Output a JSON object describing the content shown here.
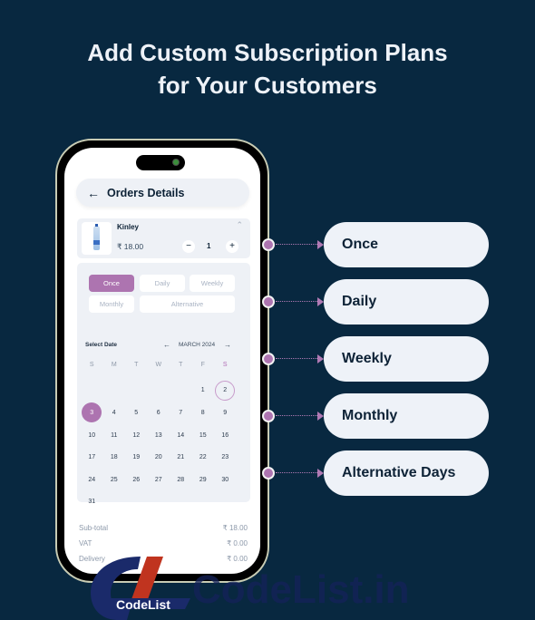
{
  "headline": {
    "line1": "Add Custom Subscription Plans",
    "line2": "for Your Customers"
  },
  "phone": {
    "header": {
      "back_icon": "arrow-left-icon",
      "title": "Orders Details"
    },
    "item": {
      "name": "Kinley",
      "price": "₹ 18.00",
      "quantity": "1",
      "minus_label": "−",
      "plus_label": "+",
      "collapse_icon": "chevron-up-icon"
    },
    "plans": {
      "options": [
        {
          "label": "Once",
          "active": true
        },
        {
          "label": "Daily",
          "active": false
        },
        {
          "label": "Weekly",
          "active": false
        },
        {
          "label": "Monthly",
          "active": false
        },
        {
          "label": "Alternative",
          "active": false
        }
      ]
    },
    "calendar": {
      "select_label": "Select Date",
      "month": "MARCH 2024",
      "prev_icon": "arrow-left-icon",
      "next_icon": "arrow-right-icon",
      "weekdays": [
        "S",
        "M",
        "T",
        "W",
        "T",
        "F",
        "S"
      ],
      "leading_blanks": 5,
      "days_in_month": 31,
      "selected_day": 3,
      "outlined_day": 2
    },
    "totals": [
      {
        "label": "Sub-total",
        "value": "₹ 18.00"
      },
      {
        "label": "VAT",
        "value": "₹ 0.00"
      },
      {
        "label": "Delivery",
        "value": "₹ 0.00"
      }
    ]
  },
  "callouts": [
    {
      "label": "Once"
    },
    {
      "label": "Daily"
    },
    {
      "label": "Weekly"
    },
    {
      "label": "Monthly"
    },
    {
      "label": "Alternative Days"
    }
  ],
  "watermark": {
    "brand": "CodeList",
    "site": "CodeList.in"
  },
  "colors": {
    "background": "#082840",
    "accent": "#ad74b0",
    "pill_bg": "#eef2f8",
    "text_dark": "#0d2236"
  }
}
